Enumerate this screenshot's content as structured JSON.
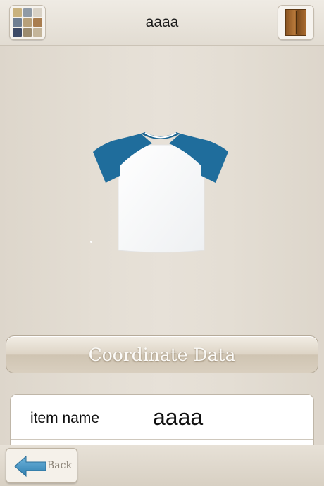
{
  "header": {
    "title": "aaaa",
    "left_button_icon": "photo-grid-icon",
    "right_button_icon": "wardrobe-icon"
  },
  "item_image": {
    "icon": "raglan-tshirt-image",
    "colors": {
      "body": "#ffffff",
      "sleeves": "#1f6d9c"
    }
  },
  "coordinate_button": {
    "label": "Coordinate Data"
  },
  "details": {
    "rows": [
      {
        "label": "item name",
        "value": "aaaa"
      }
    ]
  },
  "footer": {
    "back_label": "Back",
    "back_icon": "back-arrow-icon"
  },
  "colors": {
    "background": "#e4ded4",
    "accent_blue": "#3a86b2"
  }
}
